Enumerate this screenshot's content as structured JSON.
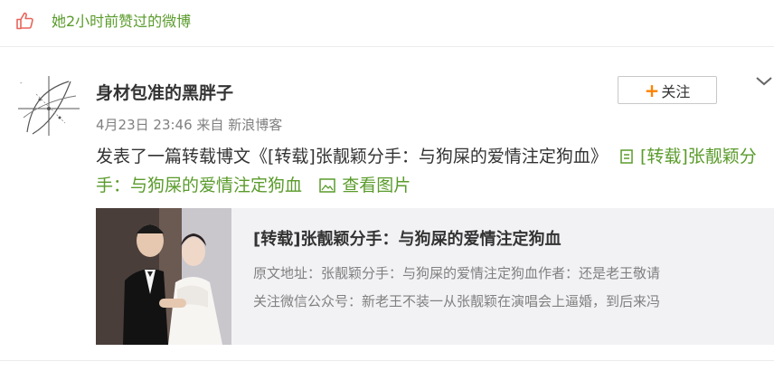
{
  "liked_bar": {
    "text": "她2小时前赞过的微博"
  },
  "author": {
    "name": "身材包准的黑胖子"
  },
  "post_meta": {
    "time": "4月23日 23:46",
    "from_label": "来自",
    "source": "新浪博客"
  },
  "follow_button": {
    "label": "关注"
  },
  "post": {
    "text": "发表了一篇转载博文《[转载]张靓颖分手：与狗屎的爱情注定狗血》",
    "article_link": "[转载]张靓颖分手：与狗屎的爱情注定狗血",
    "view_image": "查看图片"
  },
  "card": {
    "title": "[转载]张靓颖分手：与狗屎的爱情注定狗血",
    "desc_line1": "原文地址：张靓颖分手：与狗屎的爱情注定狗血作者：还是老王敬请",
    "desc_line2": "关注微信公众号：新老王不装一从张靓颖在演唱会上逼婚，到后来冯"
  },
  "colors": {
    "link_green": "#5a9b2b",
    "meta_gray": "#808080",
    "accent_orange": "#ff8200",
    "card_bg": "#f2f2f5"
  },
  "icons": [
    "thumbs-up-icon",
    "chevron-down-icon",
    "article-icon",
    "image-icon",
    "plus-icon"
  ]
}
